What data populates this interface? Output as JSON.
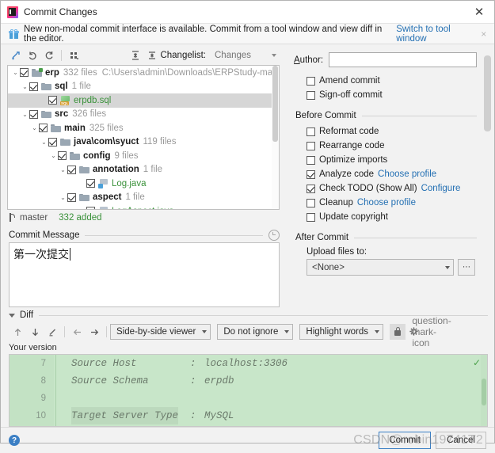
{
  "window": {
    "title": "Commit Changes",
    "app_icon": "intellij-idea-icon",
    "close_label": "✕"
  },
  "notification": {
    "icon": "gift-icon",
    "text": "New non-modal commit interface is available. Commit from a tool window and view diff in the editor.",
    "link": "Switch to tool window",
    "close_label": "×"
  },
  "tree_toolbar": {
    "buttons": [
      {
        "name": "show-diff-icon",
        "glyph": "✦"
      },
      {
        "name": "revert-icon",
        "glyph": "↺"
      },
      {
        "name": "refresh-icon",
        "glyph": "↻"
      },
      {
        "name": "group-by-icon",
        "glyph": "☰"
      },
      {
        "name": "expand-all-icon",
        "glyph": "⨍"
      },
      {
        "name": "collapse-all-icon",
        "glyph": "⨌"
      }
    ],
    "changelist_label": "Changelist:",
    "changelist_value": "Changes"
  },
  "tree": {
    "rows": [
      {
        "indent": 0,
        "arrow": "⌄",
        "checked": true,
        "icon": "folder-vcs-icon",
        "name": "erp",
        "count": "332 files",
        "path": "C:\\Users\\admin\\Downloads\\ERPStudy-main",
        "selected": false,
        "kind": "folder"
      },
      {
        "indent": 1,
        "arrow": "⌄",
        "checked": true,
        "icon": "folder-icon",
        "name": "sql",
        "count": "1 file",
        "path": "",
        "selected": false,
        "kind": "folder"
      },
      {
        "indent": 3,
        "arrow": "",
        "checked": true,
        "icon": "sql-file-icon",
        "name": "erpdb.sql",
        "count": "",
        "path": "",
        "selected": true,
        "kind": "sql"
      },
      {
        "indent": 1,
        "arrow": "⌄",
        "checked": true,
        "icon": "folder-icon",
        "name": "src",
        "count": "326 files",
        "path": "",
        "selected": false,
        "kind": "folder"
      },
      {
        "indent": 2,
        "arrow": "⌄",
        "checked": true,
        "icon": "folder-icon",
        "name": "main",
        "count": "325 files",
        "path": "",
        "selected": false,
        "kind": "folder"
      },
      {
        "indent": 3,
        "arrow": "⌄",
        "checked": true,
        "icon": "folder-icon",
        "name": "java\\com\\syuct",
        "count": "119 files",
        "path": "",
        "selected": false,
        "kind": "folder"
      },
      {
        "indent": 4,
        "arrow": "⌄",
        "checked": true,
        "icon": "folder-icon",
        "name": "config",
        "count": "9 files",
        "path": "",
        "selected": false,
        "kind": "folder"
      },
      {
        "indent": 5,
        "arrow": "⌄",
        "checked": true,
        "icon": "folder-icon",
        "name": "annotation",
        "count": "1 file",
        "path": "",
        "selected": false,
        "kind": "folder"
      },
      {
        "indent": 7,
        "arrow": "",
        "checked": true,
        "icon": "java-file-icon",
        "name": "Log.java",
        "count": "",
        "path": "",
        "selected": false,
        "kind": "java"
      },
      {
        "indent": 5,
        "arrow": "⌄",
        "checked": true,
        "icon": "folder-icon",
        "name": "aspect",
        "count": "1 file",
        "path": "",
        "selected": false,
        "kind": "folder"
      },
      {
        "indent": 7,
        "arrow": "",
        "checked": true,
        "icon": "java-file-icon",
        "name": "LogAspect.java",
        "count": "",
        "path": "",
        "selected": false,
        "kind": "java"
      }
    ]
  },
  "branch_bar": {
    "icon": "branch-icon",
    "branch": "master",
    "added": "332 added"
  },
  "commit_message": {
    "label": "Commit Message",
    "history_icon": "history-clock-icon",
    "value": "第一次提交",
    "placeholder": ""
  },
  "options": {
    "author_label": "Author:",
    "author_value": "",
    "author_placeholder": "",
    "top_checks": [
      {
        "label": "Amend commit",
        "checked": false,
        "name": "amend-commit-checkbox"
      },
      {
        "label": "Sign-off commit",
        "checked": false,
        "name": "signoff-commit-checkbox"
      }
    ],
    "before_commit_title": "Before Commit",
    "before_checks": [
      {
        "label": "Reformat code",
        "checked": false,
        "link": "",
        "name": "reformat-code-checkbox"
      },
      {
        "label": "Rearrange code",
        "checked": false,
        "link": "",
        "name": "rearrange-code-checkbox"
      },
      {
        "label": "Optimize imports",
        "checked": false,
        "link": "",
        "name": "optimize-imports-checkbox"
      },
      {
        "label": "Analyze code",
        "checked": true,
        "link": "Choose profile",
        "name": "analyze-code-checkbox"
      },
      {
        "label": "Check TODO (Show All)",
        "checked": true,
        "link": "Configure",
        "name": "check-todo-checkbox"
      },
      {
        "label": "Cleanup",
        "checked": false,
        "link": "Choose profile",
        "name": "cleanup-checkbox"
      },
      {
        "label": "Update copyright",
        "checked": false,
        "link": "",
        "name": "update-copyright-checkbox"
      }
    ],
    "after_commit_title": "After Commit",
    "upload_label": "Upload files to:",
    "upload_value": "<None>",
    "browse_label": "⋯"
  },
  "diff": {
    "section_label": "Diff",
    "toolbar_icons": [
      {
        "name": "previous-difference-icon",
        "glyph": "↑"
      },
      {
        "name": "next-difference-icon",
        "glyph": "↓"
      },
      {
        "name": "edit-source-icon",
        "glyph": "╱"
      },
      {
        "name": "accept-left-icon",
        "glyph": "←"
      },
      {
        "name": "accept-right-icon",
        "glyph": "→"
      }
    ],
    "viewer_mode": "Side-by-side viewer",
    "ignore_mode": "Do not ignore",
    "highlight_mode": "Highlight words",
    "lock_icon": "lock-icon",
    "settings_icon": "gear-icon",
    "help_icon": "question-mark-icon",
    "your_version_label": "Your version",
    "lines": [
      {
        "num": "7",
        "key": "Source Host",
        "colon": ":",
        "value": "localhost:3306",
        "highlight": false
      },
      {
        "num": "8",
        "key": "Source Schema",
        "colon": ":",
        "value": "erpdb",
        "highlight": false
      },
      {
        "num": "9",
        "key": "",
        "colon": "",
        "value": "",
        "highlight": false
      },
      {
        "num": "10",
        "key": "Target Server Type",
        "colon": ":",
        "value": "MySQL",
        "highlight": true
      }
    ],
    "check_glyph": "✓"
  },
  "footer": {
    "help_label": "?",
    "commit_label": "Commit",
    "cancel_label": "Cancel",
    "watermark": "CSDN@robin19741₮2"
  },
  "colors": {
    "link": "#2470b3",
    "added_green": "#3a913a",
    "diff_bg": "#c8e6c9",
    "accent": "#3b7fc4",
    "selection": "#d6d6d6"
  }
}
